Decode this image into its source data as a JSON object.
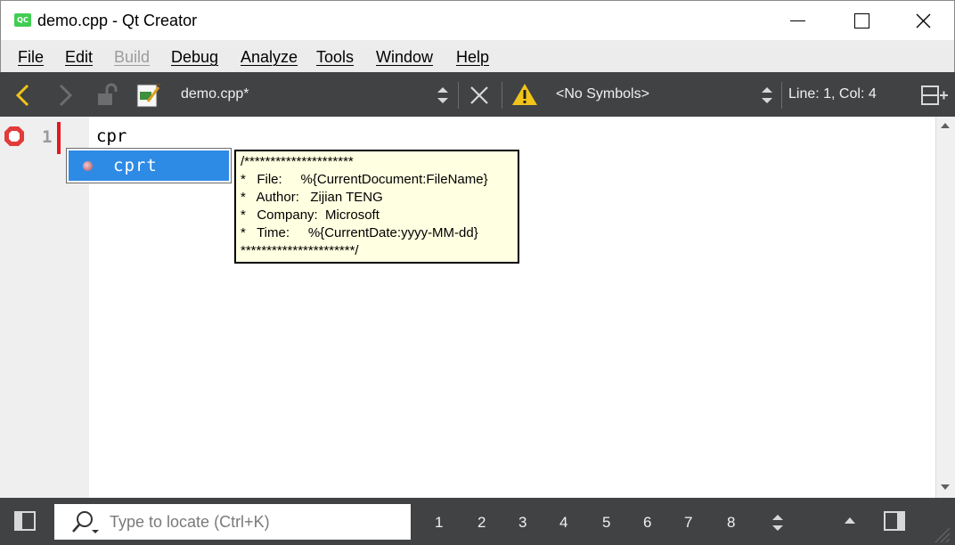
{
  "window": {
    "title": "demo.cpp - Qt Creator",
    "app_icon_text": "QC",
    "icons": {
      "minimize": "minimize-icon",
      "maximize": "maximize-icon",
      "close": "close-icon"
    }
  },
  "menubar": {
    "items": [
      {
        "label": "File",
        "enabled": true
      },
      {
        "label": "Edit",
        "enabled": true
      },
      {
        "label": "Build",
        "enabled": false
      },
      {
        "label": "Debug",
        "enabled": true
      },
      {
        "label": "Analyze",
        "enabled": true
      },
      {
        "label": "Tools",
        "enabled": true
      },
      {
        "label": "Window",
        "enabled": true
      },
      {
        "label": "Help",
        "enabled": true
      }
    ]
  },
  "toolbar": {
    "document": "demo.cpp*",
    "symbols": "<No Symbols>",
    "position": "Line: 1, Col: 4",
    "icons": [
      "back-icon",
      "forward-icon",
      "lock-icon",
      "document-icon",
      "dropdown-arrows-icon",
      "close-document-icon",
      "warning-icon",
      "split-icon"
    ]
  },
  "editor": {
    "line_number": "1",
    "code": "cpr"
  },
  "completion": {
    "item": "cprt",
    "tooltip_lines": [
      "/*********************",
      "*   File:     %{CurrentDocument:FileName}",
      "*   Author:   Zijian TENG",
      "*   Company:  Microsoft",
      "*   Time:     %{CurrentDate:yyyy-MM-dd}",
      "**********************/"
    ]
  },
  "statusbar": {
    "locator_placeholder": "Type to locate (Ctrl+K)",
    "pane_buttons": [
      "1",
      "2",
      "3",
      "4",
      "5",
      "6",
      "7",
      "8"
    ]
  },
  "colors": {
    "toolbar_bg": "#404244",
    "selection": "#2d8be6",
    "tooltip_bg": "#ffffe1",
    "change_marker": "#e4181f",
    "qt_green": "#41cd52",
    "warning": "#f0c419"
  }
}
